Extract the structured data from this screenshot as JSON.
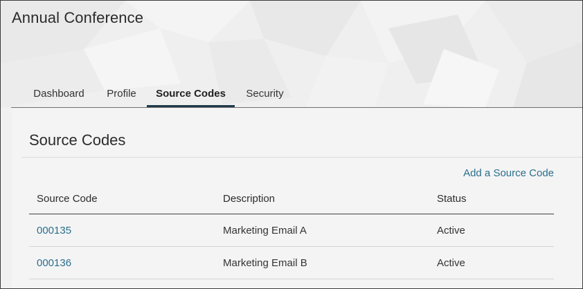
{
  "app": {
    "title": "Annual Conference"
  },
  "tabs": [
    {
      "label": "Dashboard",
      "active": false
    },
    {
      "label": "Profile",
      "active": false
    },
    {
      "label": "Source Codes",
      "active": true
    },
    {
      "label": "Security",
      "active": false
    }
  ],
  "section": {
    "title": "Source Codes",
    "add_link": "Add a Source Code"
  },
  "table": {
    "headers": [
      "Source Code",
      "Description",
      "Status"
    ],
    "rows": [
      {
        "code": "000135",
        "description": "Marketing Email A",
        "status": "Active"
      },
      {
        "code": "000136",
        "description": "Marketing Email B",
        "status": "Active"
      }
    ]
  },
  "colors": {
    "link": "#2a6e8c",
    "active_tab_underline": "#1f3a4a"
  }
}
